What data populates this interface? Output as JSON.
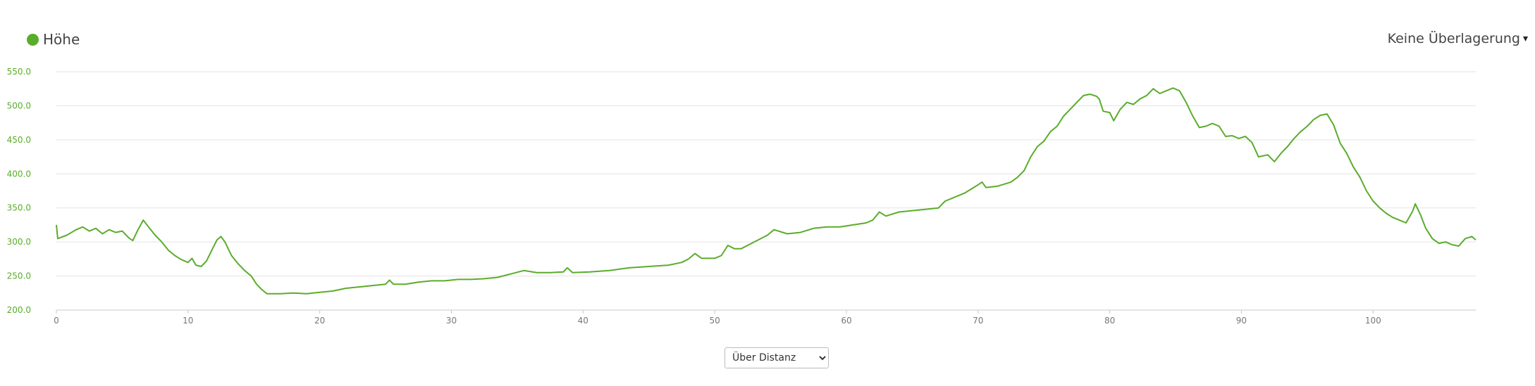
{
  "legend": {
    "label": "Höhe",
    "color": "#5aac2b"
  },
  "overlay": {
    "label": "Keine Überlagerung",
    "caret": "▾"
  },
  "mode_select": {
    "selected": "Über Distanz"
  },
  "chart_data": {
    "type": "line",
    "y_ticks": [
      "200.0",
      "250.0",
      "300.0",
      "350.0",
      "400.0",
      "450.0",
      "500.0",
      "550.0"
    ],
    "x_ticks": [
      "0",
      "10",
      "20",
      "30",
      "40",
      "50",
      "60",
      "70",
      "80",
      "90",
      "100"
    ],
    "xlim": [
      0,
      107.8
    ],
    "ylim": [
      200,
      550
    ],
    "grid": true,
    "legend_position": "top-left",
    "series": [
      {
        "name": "Höhe",
        "color": "#5aac2b",
        "points": [
          [
            0,
            325
          ],
          [
            0.1,
            305
          ],
          [
            0.8,
            310
          ],
          [
            1.5,
            318
          ],
          [
            2.0,
            322
          ],
          [
            2.5,
            316
          ],
          [
            3.0,
            320
          ],
          [
            3.5,
            312
          ],
          [
            4.0,
            318
          ],
          [
            4.5,
            314
          ],
          [
            5.0,
            316
          ],
          [
            5.5,
            306
          ],
          [
            5.8,
            302
          ],
          [
            6.2,
            318
          ],
          [
            6.6,
            332
          ],
          [
            7.0,
            322
          ],
          [
            7.5,
            310
          ],
          [
            8.0,
            300
          ],
          [
            8.5,
            288
          ],
          [
            9.0,
            280
          ],
          [
            9.5,
            274
          ],
          [
            10.0,
            270
          ],
          [
            10.3,
            276
          ],
          [
            10.6,
            266
          ],
          [
            11.0,
            264
          ],
          [
            11.4,
            272
          ],
          [
            11.8,
            288
          ],
          [
            12.2,
            303
          ],
          [
            12.5,
            308
          ],
          [
            12.8,
            300
          ],
          [
            13.3,
            280
          ],
          [
            13.8,
            268
          ],
          [
            14.3,
            258
          ],
          [
            14.8,
            250
          ],
          [
            15.2,
            238
          ],
          [
            15.6,
            230
          ],
          [
            16.0,
            224
          ],
          [
            17.0,
            224
          ],
          [
            18.0,
            225
          ],
          [
            19.0,
            224
          ],
          [
            20.0,
            226
          ],
          [
            21.0,
            228
          ],
          [
            22.0,
            232
          ],
          [
            23.0,
            234
          ],
          [
            24.0,
            236
          ],
          [
            25.0,
            238
          ],
          [
            25.3,
            244
          ],
          [
            25.6,
            238
          ],
          [
            26.5,
            238
          ],
          [
            27.5,
            241
          ],
          [
            28.5,
            243
          ],
          [
            29.5,
            243
          ],
          [
            30.5,
            245
          ],
          [
            31.5,
            245
          ],
          [
            32.5,
            246
          ],
          [
            33.5,
            248
          ],
          [
            34.5,
            253
          ],
          [
            35.5,
            258
          ],
          [
            36.5,
            255
          ],
          [
            37.5,
            255
          ],
          [
            38.5,
            256
          ],
          [
            38.8,
            262
          ],
          [
            39.2,
            255
          ],
          [
            40.5,
            256
          ],
          [
            42.0,
            258
          ],
          [
            43.5,
            262
          ],
          [
            45.0,
            264
          ],
          [
            46.5,
            266
          ],
          [
            47.5,
            270
          ],
          [
            48.0,
            275
          ],
          [
            48.5,
            283
          ],
          [
            49.0,
            276
          ],
          [
            50.0,
            276
          ],
          [
            50.5,
            280
          ],
          [
            51.0,
            295
          ],
          [
            51.5,
            290
          ],
          [
            52.0,
            290
          ],
          [
            53.0,
            300
          ],
          [
            54.0,
            310
          ],
          [
            54.5,
            318
          ],
          [
            55.5,
            312
          ],
          [
            56.5,
            314
          ],
          [
            57.5,
            320
          ],
          [
            58.5,
            322
          ],
          [
            59.5,
            322
          ],
          [
            60.5,
            325
          ],
          [
            61.5,
            328
          ],
          [
            62.0,
            332
          ],
          [
            62.5,
            344
          ],
          [
            63.0,
            338
          ],
          [
            64.0,
            344
          ],
          [
            65.0,
            346
          ],
          [
            66.0,
            348
          ],
          [
            67.0,
            350
          ],
          [
            67.5,
            360
          ],
          [
            68.0,
            364
          ],
          [
            68.5,
            368
          ],
          [
            69.0,
            372
          ],
          [
            69.5,
            378
          ],
          [
            70.0,
            384
          ],
          [
            70.3,
            388
          ],
          [
            70.6,
            380
          ],
          [
            71.5,
            382
          ],
          [
            72.5,
            388
          ],
          [
            73.0,
            395
          ],
          [
            73.5,
            405
          ],
          [
            74.0,
            425
          ],
          [
            74.5,
            440
          ],
          [
            75.0,
            448
          ],
          [
            75.5,
            462
          ],
          [
            76.0,
            470
          ],
          [
            76.5,
            485
          ],
          [
            77.0,
            495
          ],
          [
            77.5,
            505
          ],
          [
            78.0,
            515
          ],
          [
            78.5,
            517
          ],
          [
            79.0,
            514
          ],
          [
            79.2,
            510
          ],
          [
            79.5,
            492
          ],
          [
            80.0,
            490
          ],
          [
            80.3,
            478
          ],
          [
            80.8,
            495
          ],
          [
            81.3,
            505
          ],
          [
            81.8,
            502
          ],
          [
            82.3,
            510
          ],
          [
            82.8,
            515
          ],
          [
            83.3,
            525
          ],
          [
            83.8,
            518
          ],
          [
            84.3,
            522
          ],
          [
            84.8,
            526
          ],
          [
            85.3,
            522
          ],
          [
            85.8,
            505
          ],
          [
            86.3,
            485
          ],
          [
            86.8,
            468
          ],
          [
            87.3,
            470
          ],
          [
            87.8,
            474
          ],
          [
            88.3,
            470
          ],
          [
            88.8,
            455
          ],
          [
            89.3,
            456
          ],
          [
            89.8,
            452
          ],
          [
            90.3,
            455
          ],
          [
            90.8,
            446
          ],
          [
            91.3,
            425
          ],
          [
            92.0,
            428
          ],
          [
            92.5,
            418
          ],
          [
            93.0,
            430
          ],
          [
            93.5,
            440
          ],
          [
            94.0,
            452
          ],
          [
            94.5,
            462
          ],
          [
            95.0,
            470
          ],
          [
            95.5,
            480
          ],
          [
            96.0,
            486
          ],
          [
            96.5,
            488
          ],
          [
            97.0,
            472
          ],
          [
            97.5,
            445
          ],
          [
            98.0,
            430
          ],
          [
            98.5,
            410
          ],
          [
            99.0,
            395
          ],
          [
            99.5,
            375
          ],
          [
            100.0,
            360
          ],
          [
            100.5,
            350
          ],
          [
            101.0,
            342
          ],
          [
            101.5,
            336
          ],
          [
            102.0,
            332
          ],
          [
            102.5,
            328
          ],
          [
            103.0,
            345
          ],
          [
            103.2,
            356
          ],
          [
            103.6,
            340
          ],
          [
            104.0,
            320
          ],
          [
            104.5,
            305
          ],
          [
            105.0,
            298
          ],
          [
            105.5,
            300
          ],
          [
            106.0,
            296
          ],
          [
            106.5,
            294
          ],
          [
            107.0,
            305
          ],
          [
            107.5,
            308
          ],
          [
            107.8,
            303
          ]
        ]
      }
    ]
  }
}
